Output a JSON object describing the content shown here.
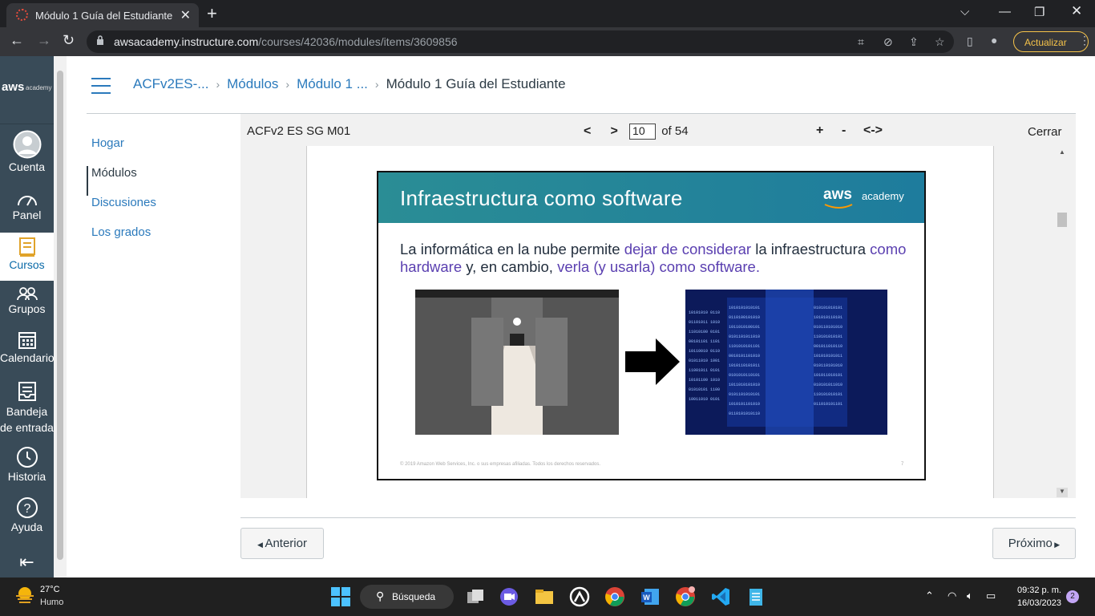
{
  "browser": {
    "tab_title": "Módulo 1 Guía del Estudiante",
    "url_domain": "awsacademy.instructure.com",
    "url_path": "/courses/42036/modules/items/3609856",
    "update_label": "Actualizar"
  },
  "global_nav": {
    "logo_text": "aws",
    "logo_sub": "academy",
    "items": [
      {
        "label": "Cuenta",
        "icon": "account-icon"
      },
      {
        "label": "Panel",
        "icon": "dashboard-icon"
      },
      {
        "label": "Cursos",
        "icon": "courses-icon",
        "active": true
      },
      {
        "label": "Grupos",
        "icon": "groups-icon"
      },
      {
        "label": "Calendario",
        "icon": "calendar-icon"
      },
      {
        "label": "Bandeja de entrada",
        "icon": "inbox-icon"
      },
      {
        "label": "Historia",
        "icon": "history-icon"
      },
      {
        "label": "Ayuda",
        "icon": "help-icon"
      }
    ]
  },
  "breadcrumb": [
    "ACFv2ES-...",
    "Módulos",
    "Módulo 1 ...",
    "Módulo 1 Guía del Estudiante"
  ],
  "course_nav": [
    "Hogar",
    "Módulos",
    "Discusiones",
    "Los grados"
  ],
  "viewer": {
    "doc_name": "ACFv2 ES SG M01",
    "prev": "<",
    "next": ">",
    "page": "10",
    "page_total": "of 54",
    "zoom_in": "+",
    "zoom_out": "-",
    "fit": "<->",
    "close": "Cerrar"
  },
  "slide": {
    "title": "Infraestructura como software",
    "brand": "aws",
    "brand_sub": "academy",
    "text_1": "La informática en la nube permite ",
    "text_hl1": "dejar de considerar",
    "text_2": " la infraestructura ",
    "text_hl2": "como hardware",
    "text_3": " y, en cambio, ",
    "text_hl3": "verla (y usarla) como software.",
    "footer": "© 2019 Amazon Web Services, Inc. o sus empresas afiliadas. Todos los derechos reservados.",
    "page_num": "7",
    "colors": {
      "band": "#2a8d95",
      "highlight": "#5a3fb0"
    }
  },
  "footer_nav": {
    "prev": "Anterior",
    "next": "Próximo"
  },
  "taskbar": {
    "temp": "27°C",
    "weather": "Humo",
    "search": "Búsqueda",
    "time": "09:32 p. m.",
    "date": "16/03/2023",
    "notifications": "2"
  }
}
